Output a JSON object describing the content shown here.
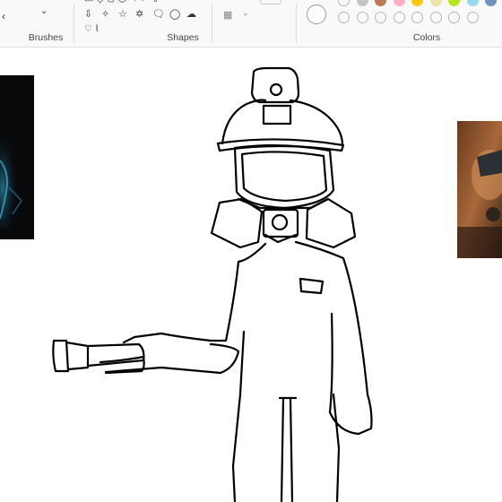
{
  "ribbon": {
    "groups": {
      "brushes": "Brushes",
      "shapes": "Shapes",
      "colors": "Colors"
    },
    "shape_icons": [
      "arrow-down-shape",
      "star-four-shape",
      "star-five-shape",
      "star-six-shape",
      "callout-rect-shape",
      "callout-oval-shape",
      "callout-cloud-shape"
    ],
    "palette_top": [
      "#ffffff",
      "#c3c3c3",
      "#b97a57",
      "#ffaec9",
      "#ffc90e",
      "#efe4b0",
      "#b5e61d",
      "#99d9ea",
      "#7092be",
      "#c8bfe7"
    ],
    "accent": "#0067c0"
  },
  "canvas": {
    "background": "#ffffff",
    "stroke_color": "#000000",
    "subject": "miner-suit-figure"
  },
  "side_images": [
    "dark-video-thumbnail-left",
    "photo-thumbnail-right"
  ]
}
